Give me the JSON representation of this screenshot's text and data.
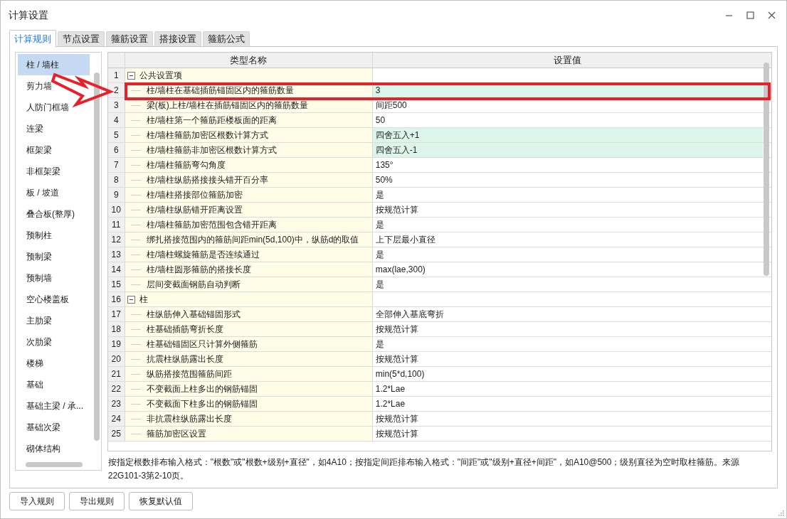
{
  "window": {
    "title": "计算设置"
  },
  "tabs": [
    {
      "label": "计算规则",
      "selected": true
    },
    {
      "label": "节点设置",
      "selected": false
    },
    {
      "label": "箍筋设置",
      "selected": false
    },
    {
      "label": "搭接设置",
      "selected": false
    },
    {
      "label": "箍筋公式",
      "selected": false
    }
  ],
  "sidebar": {
    "items": [
      {
        "label": "柱 / 墙柱",
        "selected": true
      },
      {
        "label": "剪力墙",
        "selected": false
      },
      {
        "label": "人防门框墙",
        "selected": false
      },
      {
        "label": "连梁",
        "selected": false
      },
      {
        "label": "框架梁",
        "selected": false
      },
      {
        "label": "非框架梁",
        "selected": false
      },
      {
        "label": "板 / 坡道",
        "selected": false
      },
      {
        "label": "叠合板(整厚)",
        "selected": false
      },
      {
        "label": "预制柱",
        "selected": false
      },
      {
        "label": "预制梁",
        "selected": false
      },
      {
        "label": "预制墙",
        "selected": false
      },
      {
        "label": "空心楼盖板",
        "selected": false
      },
      {
        "label": "主肋梁",
        "selected": false
      },
      {
        "label": "次肋梁",
        "selected": false
      },
      {
        "label": "楼梯",
        "selected": false
      },
      {
        "label": "基础",
        "selected": false
      },
      {
        "label": "基础主梁 / 承...",
        "selected": false
      },
      {
        "label": "基础次梁",
        "selected": false
      },
      {
        "label": "砌体结构",
        "selected": false
      }
    ]
  },
  "table": {
    "columns": [
      "类型名称",
      "设置值"
    ],
    "rows": [
      {
        "num": "1",
        "kind": "group",
        "name": "公共设置项",
        "expanded": true
      },
      {
        "num": "2",
        "kind": "item",
        "name": "柱/墙柱在基础插筋锚固区内的箍筋数量",
        "value": "3",
        "modified": true
      },
      {
        "num": "3",
        "kind": "item",
        "name": "梁(板)上柱/墙柱在插筋锚固区内的箍筋数量",
        "value": "间距500",
        "modified": false
      },
      {
        "num": "4",
        "kind": "item",
        "name": "柱/墙柱第一个箍筋距楼板面的距离",
        "value": "50",
        "modified": false
      },
      {
        "num": "5",
        "kind": "item",
        "name": "柱/墙柱箍筋加密区根数计算方式",
        "value": "四舍五入+1",
        "modified": true
      },
      {
        "num": "6",
        "kind": "item",
        "name": "柱/墙柱箍筋非加密区根数计算方式",
        "value": "四舍五入-1",
        "modified": true
      },
      {
        "num": "7",
        "kind": "item",
        "name": "柱/墙柱箍筋弯勾角度",
        "value": "135°",
        "modified": false
      },
      {
        "num": "8",
        "kind": "item",
        "name": "柱/墙柱纵筋搭接接头错开百分率",
        "value": "50%",
        "modified": false
      },
      {
        "num": "9",
        "kind": "item",
        "name": "柱/墙柱搭接部位箍筋加密",
        "value": "是",
        "modified": false
      },
      {
        "num": "10",
        "kind": "item",
        "name": "柱/墙柱纵筋错开距离设置",
        "value": "按规范计算",
        "modified": false
      },
      {
        "num": "11",
        "kind": "item",
        "name": "柱/墙柱箍筋加密范围包含错开距离",
        "value": "是",
        "modified": false
      },
      {
        "num": "12",
        "kind": "item",
        "name": "绑扎搭接范围内的箍筋间距min(5d,100)中，纵筋d的取值",
        "value": "上下层最小直径",
        "modified": false
      },
      {
        "num": "13",
        "kind": "item",
        "name": "柱/墙柱螺旋箍筋是否连续通过",
        "value": "是",
        "modified": false
      },
      {
        "num": "14",
        "kind": "item",
        "name": "柱/墙柱圆形箍筋的搭接长度",
        "value": "max(lae,300)",
        "modified": false
      },
      {
        "num": "15",
        "kind": "item",
        "name": "层间变截面钢筋自动判断",
        "value": "是",
        "modified": false
      },
      {
        "num": "16",
        "kind": "group",
        "name": "柱",
        "expanded": true
      },
      {
        "num": "17",
        "kind": "item",
        "name": "柱纵筋伸入基础锚固形式",
        "value": "全部伸入基底弯折",
        "modified": false
      },
      {
        "num": "18",
        "kind": "item",
        "name": "柱基础插筋弯折长度",
        "value": "按规范计算",
        "modified": false
      },
      {
        "num": "19",
        "kind": "item",
        "name": "柱基础锚固区只计算外侧箍筋",
        "value": "是",
        "modified": false
      },
      {
        "num": "20",
        "kind": "item",
        "name": "抗震柱纵筋露出长度",
        "value": "按规范计算",
        "modified": false
      },
      {
        "num": "21",
        "kind": "item",
        "name": "纵筋搭接范围箍筋间距",
        "value": "min(5*d,100)",
        "modified": false
      },
      {
        "num": "22",
        "kind": "item",
        "name": "不变截面上柱多出的钢筋锚固",
        "value": "1.2*Lae",
        "modified": false
      },
      {
        "num": "23",
        "kind": "item",
        "name": "不变截面下柱多出的钢筋锚固",
        "value": "1.2*Lae",
        "modified": false
      },
      {
        "num": "24",
        "kind": "item",
        "name": "非抗震柱纵筋露出长度",
        "value": "按规范计算",
        "modified": false
      },
      {
        "num": "25",
        "kind": "item",
        "name": "箍筋加密区设置",
        "value": "按规范计算",
        "modified": false
      }
    ]
  },
  "help_text": "按指定根数排布输入格式：\"根数\"或\"根数+级别+直径\"，如4A10；按指定间距排布输入格式：\"间距\"或\"级别+直径+间距\"，如A10@500；级别直径为空时取柱箍筋。来源22G101-3第2-10页。",
  "buttons": [
    "导入规则",
    "导出规则",
    "恢复默认值"
  ]
}
